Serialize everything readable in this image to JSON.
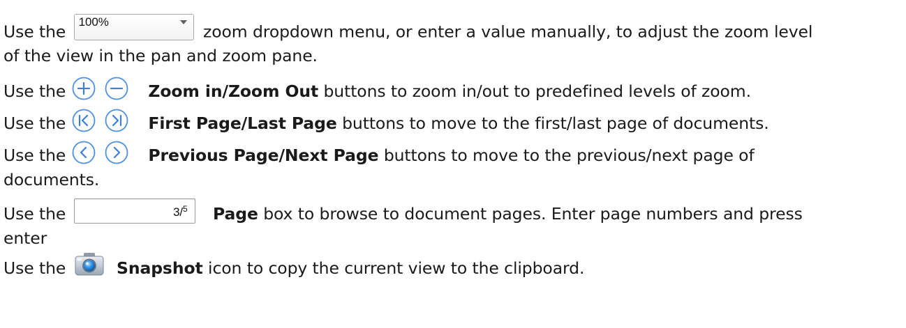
{
  "colors": {
    "text": "#1a1a1a",
    "icon_blue": "#3a7fd8",
    "icon_ring": "#4f8fe0"
  },
  "zoom_dropdown": {
    "value": "100%",
    "icon": "chevron-down-icon"
  },
  "page_box": {
    "current": "3",
    "separator": "/",
    "total": "5"
  },
  "paragraphs": {
    "p1": {
      "pre": "Use the",
      "post_line1": "zoom dropdown menu, or enter a value manually, to adjust the zoom level",
      "line2": "of the view in the pan and zoom pane."
    },
    "p2": {
      "pre": "Use the",
      "bold": "Zoom in/Zoom Out",
      "post": "buttons to zoom in/out to predefined levels of zoom.",
      "icons": [
        "zoom-in-icon",
        "zoom-out-icon"
      ]
    },
    "p3": {
      "pre": "Use the",
      "bold": "First Page/Last Page",
      "post": "buttons to move to the first/last page of documents.",
      "icons": [
        "first-page-icon",
        "last-page-icon"
      ]
    },
    "p4": {
      "pre": "Use the",
      "bold": "Previous Page/Next Page",
      "post": "buttons to move to the previous/next page of",
      "line2": "documents.",
      "icons": [
        "previous-page-icon",
        "next-page-icon"
      ]
    },
    "p5": {
      "pre": "Use the",
      "bold": "Page",
      "post": "box to browse to document pages. Enter page numbers and press",
      "line2": "enter"
    },
    "p6": {
      "pre": "Use the",
      "bold": "Snapshot",
      "post": "icon to copy the current view to the clipboard.",
      "icon": "camera-icon"
    }
  }
}
